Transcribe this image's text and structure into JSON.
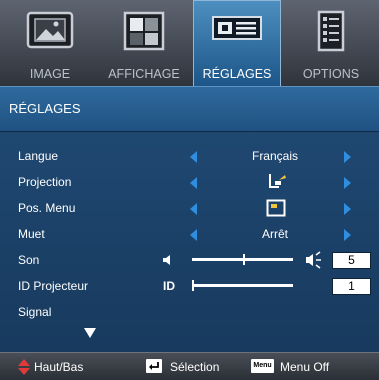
{
  "tabs": [
    {
      "label": "IMAGE",
      "icon": "picture-icon"
    },
    {
      "label": "AFFICHAGE",
      "icon": "display-icon"
    },
    {
      "label": "RÉGLAGES",
      "icon": "settings-icon"
    },
    {
      "label": "OPTIONS",
      "icon": "options-icon"
    }
  ],
  "active_tab": "RÉGLAGES",
  "header": {
    "title": "RÉGLAGES"
  },
  "settings": {
    "langue": {
      "label": "Langue",
      "value": "Français"
    },
    "projection": {
      "label": "Projection",
      "icon": "projection-mode-icon"
    },
    "pos_menu": {
      "label": "Pos. Menu",
      "icon": "menu-position-icon"
    },
    "muet": {
      "label": "Muet",
      "value": "Arrêt"
    },
    "son": {
      "label": "Son",
      "value": "5",
      "level": 0.5
    },
    "id_projecteur": {
      "label": "ID Projecteur",
      "value": "1",
      "icon_text": "ID",
      "level": 0.0
    },
    "signal": {
      "label": "Signal"
    }
  },
  "footer": {
    "nav_label": "Haut/Bas",
    "select_label": "Sélection",
    "menu_key": "Menu",
    "menu_off_label": "Menu Off"
  },
  "colors": {
    "accent": "#2f8ee0",
    "highlight": "#2f6a9e",
    "nav_arrow": "#e23a3a"
  }
}
